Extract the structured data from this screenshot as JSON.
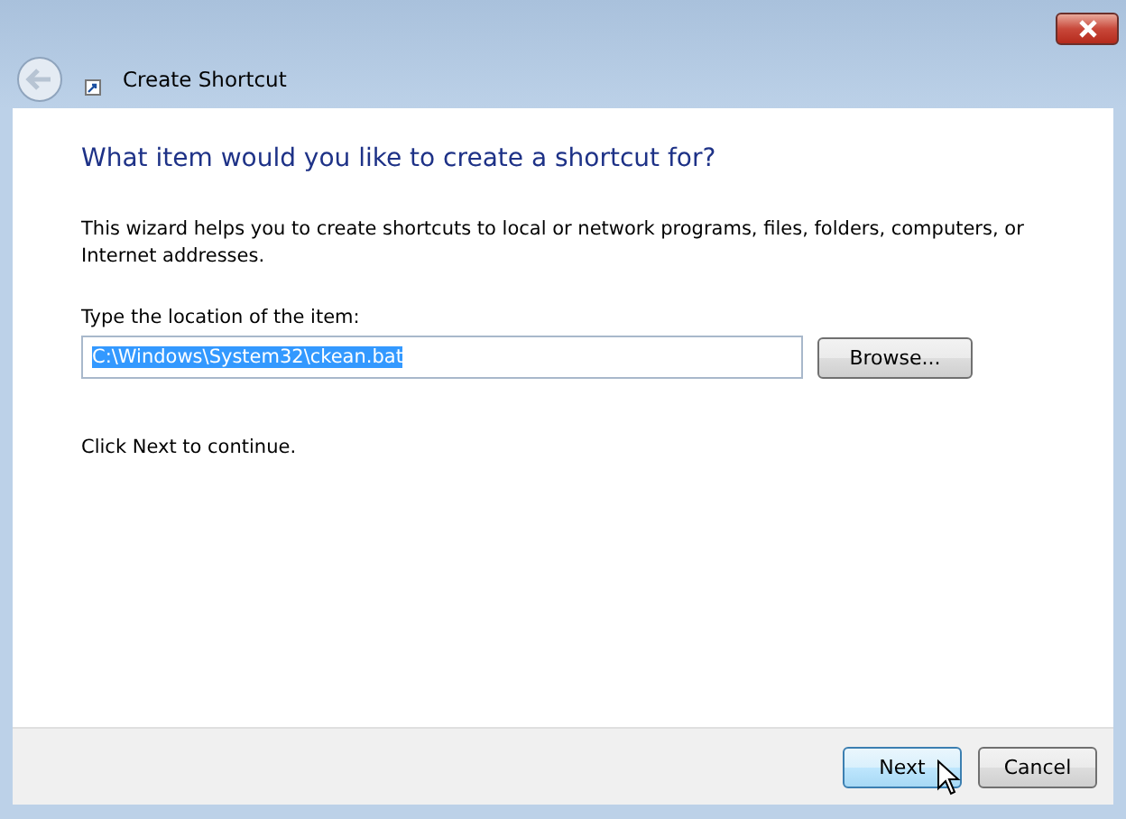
{
  "window": {
    "title": "Create Shortcut"
  },
  "heading": "What item would you like to create a shortcut for?",
  "description": "This wizard helps you to create shortcuts to local or network programs, files, folders, computers, or Internet addresses.",
  "location": {
    "label": "Type the location of the item:",
    "value": "C:\\Windows\\System32\\ckean.bat",
    "text_selected": true
  },
  "browse_button": "Browse...",
  "hint": "Click Next to continue.",
  "buttons": [
    {
      "label": "Next",
      "default": true
    },
    {
      "label": "Cancel",
      "default": false
    }
  ]
}
